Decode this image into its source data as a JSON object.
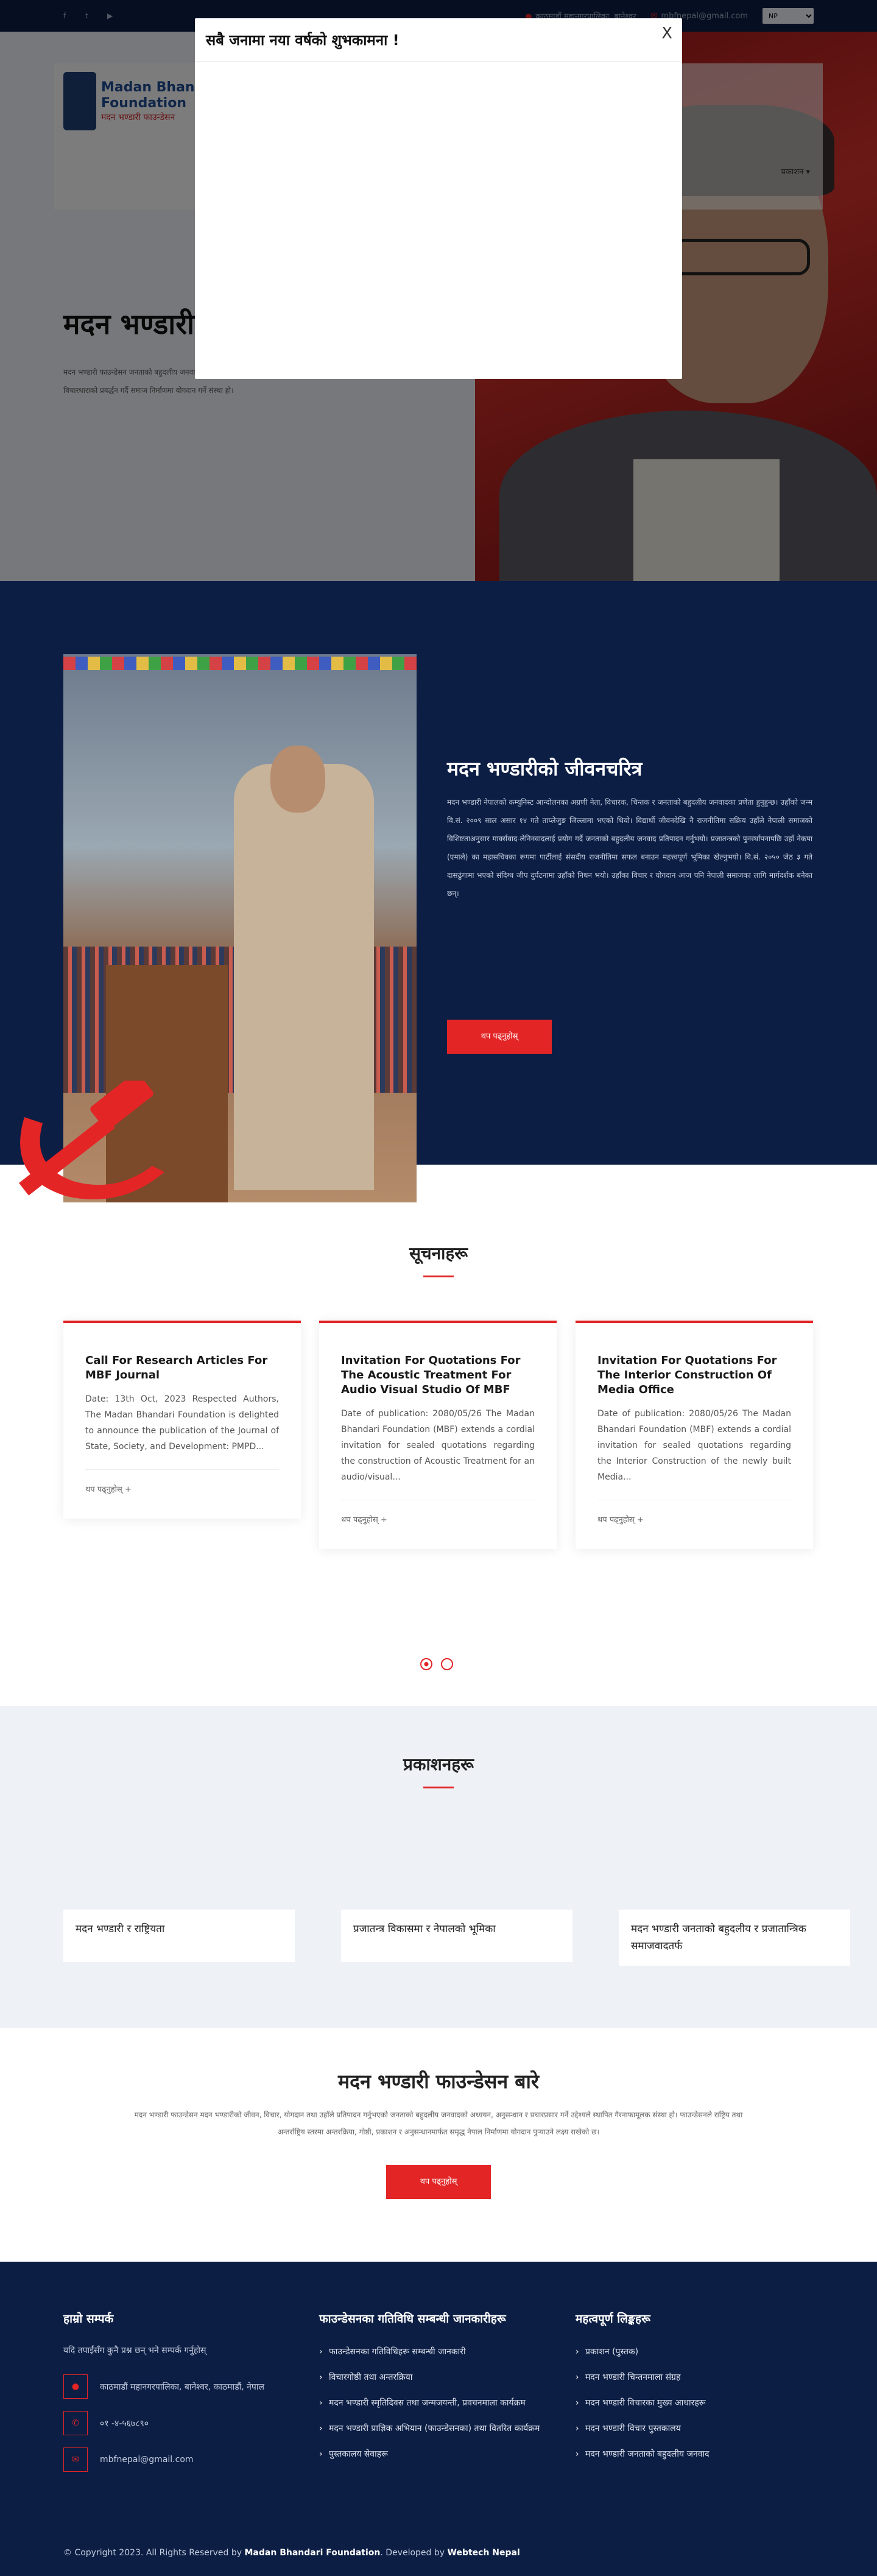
{
  "topbar": {
    "location": "काठमाडौं महानगरपालिका, बानेश्वर",
    "email": "mbfnepal@gmail.com",
    "language": "NP",
    "social_icons": [
      "facebook-icon",
      "twitter-icon",
      "youtube-icon"
    ]
  },
  "header": {
    "logo_line1": "Madan Bhandari",
    "logo_line2": "Foundation",
    "logo_devanagari": "मदन भण्डारी फाउन्डेसन",
    "nav_last": "प्रकाशन"
  },
  "hero": {
    "title": "मदन भण्डारी फाउन्डेसन",
    "description": "मदन भण्डारी फाउन्डेसन जनताको बहुदलीय जनवादको सिद्धान्त र विचारधाराको प्रवर्द्धन गर्दै समाज निर्माणमा योगदान गर्ने संस्था हो।"
  },
  "modal": {
    "title": "सबै जनामा नया वर्षको शुभकामना !",
    "close": "X"
  },
  "about": {
    "heading": "मदन भण्डारीको जीवनचरित्र",
    "text": "मदन भण्डारी नेपालको कम्युनिस्ट आन्दोलनका अग्रणी नेता, विचारक, चिन्तक र जनताको बहुदलीय जनवादका प्रणेता हुनुहुन्छ। उहाँको जन्म वि.सं. २००९ साल असार १४ गते ताप्लेजुङ जिल्लामा भएको थियो। विद्यार्थी जीवनदेखि नै राजनीतिमा सक्रिय उहाँले नेपाली समाजको विशिष्टताअनुसार मार्क्सवाद-लेनिनवादलाई प्रयोग गर्दै जनताको बहुदलीय जनवाद प्रतिपादन गर्नुभयो। प्रजातन्त्रको पुनर्स्थापनापछि उहाँ नेकपा (एमाले) का महासचिवका रूपमा पार्टीलाई संसदीय राजनीतिमा सफल बनाउन महत्त्वपूर्ण भूमिका खेल्नुभयो। वि.सं. २०५० जेठ ३ गते दासढुंगामा भएको संदिग्ध जीप दुर्घटनामा उहाँको निधन भयो। उहाँका विचार र योगदान आज पनि नेपाली समाजका लागि मार्गदर्शक बनेका छन्।",
    "button": "थप पढ्नुहोस्"
  },
  "notices": {
    "title": "सूचनाहरू",
    "more": "थप पढ्नुहोस् +",
    "items": [
      {
        "title": "Call For Research Articles For MBF Journal",
        "excerpt": "Date: 13th Oct, 2023 Respected Authors, The Madan Bhandari Foundation is delighted to announce the publication of the Journal of State, Society, and Development: PMPD..."
      },
      {
        "title": "Invitation For Quotations For The Acoustic Treatment For Audio Visual Studio Of MBF",
        "excerpt": "Date of publication: 2080/05/26 The Madan Bhandari Foundation (MBF) extends a cordial invitation for sealed quotations regarding the construction of Acoustic Treatment for an audio/visual..."
      },
      {
        "title": "Invitation For Quotations For The Interior Construction Of Media Office",
        "excerpt": "Date of publication: 2080/05/26 The Madan Bhandari Foundation (MBF) extends a cordial invitation for sealed quotations regarding the Interior Construction of the newly built Media..."
      }
    ]
  },
  "publications": {
    "title": "प्रकाशनहरू",
    "items": [
      "मदन भण्डारी र राष्ट्रियता",
      "प्रजातन्त्र विकासमा र नेपालको भूमिका",
      "मदन भण्डारी जनताको बहुदलीय र प्रजातान्त्रिक समाजवादतर्फ"
    ]
  },
  "intro": {
    "heading": "मदन भण्डारी फाउन्डेसन बारे",
    "text": "मदन भण्डारी फाउन्डेसन मदन भण्डारीको जीवन, विचार, योगदान तथा उहाँले प्रतिपादन गर्नुभएको जनताको बहुदलीय जनवादको अध्ययन, अनुसन्धान र प्रचारप्रसार गर्ने उद्देश्यले स्थापित गैरनाफामूलक संस्था हो। फाउन्डेसनले राष्ट्रिय तथा अन्तर्राष्ट्रिय स्तरमा अन्तरक्रिया, गोष्ठी, प्रकाशन र अनुसन्धानमार्फत समृद्ध नेपाल निर्माणमा योगदान पुर्‍याउने लक्ष्य राखेको छ।",
    "button": "थप पढ्नुहोस्"
  },
  "footer": {
    "col1_title": "हाम्रो सम्पर्क",
    "col1_info": "यदि तपाईंसँग कुनै प्रश्न छन् भने सम्पर्क गर्नुहोस्",
    "address": "काठमाडौं महानगरपालिका, बानेश्वर, काठमाडौं, नेपाल",
    "phone": "०१ -४-५६७८९०",
    "email": "mbfnepal@gmail.com",
    "col2_title": "फाउन्डेसनका गतिविधि सम्बन्धी जानकारीहरू",
    "col2_links": [
      "फाउन्डेसनका गतिविधिहरू सम्बन्धी जानकारी",
      "विचारगोष्ठी तथा अन्तरक्रिया",
      "मदन भण्डारी स्मृतिदिवस तथा जन्मजयन्ती, प्रवचनमाला कार्यक्रम",
      "मदन भण्डारी प्राज्ञिक अभियान (फाउन्डेसनका) तथा वितरित कार्यक्रम",
      "पुस्तकालय सेवाहरू"
    ],
    "col3_title": "महत्वपूर्ण लिङ्कहरू",
    "col3_links": [
      "प्रकाशन (पुस्तक)",
      "मदन भण्डारी चिन्तनमाला संग्रह",
      "मदन भण्डारी विचारका मुख्य आधारहरू",
      "मदन भण्डारी विचार पुस्तकालय",
      "मदन भण्डारी जनताको बहुदलीय जनवाद"
    ],
    "copyright_pre": "© Copyright 2023. All Rights Reserved by",
    "copyright_org": "Madan Bhandari Foundation",
    "copyright_mid": ". Developed by",
    "copyright_dev": "Webtech Nepal"
  },
  "colors": {
    "navy": "#0c1e44",
    "accent": "#e32526",
    "light_bg": "#eef1f6"
  }
}
